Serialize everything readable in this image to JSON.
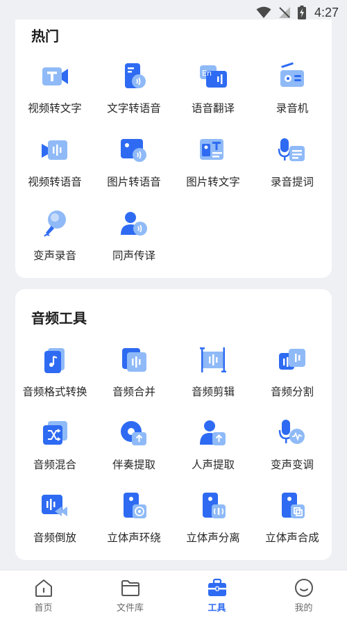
{
  "status": {
    "time": "4:27"
  },
  "colors": {
    "accent": "#2e6bf2",
    "accent_light": "#8fbaf7",
    "card": "#ffffff",
    "bg": "#eef0f4"
  },
  "hot": {
    "title": "热门",
    "items": [
      {
        "label": "视频转文字",
        "icon": "video-to-text-icon"
      },
      {
        "label": "文字转语音",
        "icon": "text-to-speech-icon"
      },
      {
        "label": "语音翻译",
        "icon": "voice-translate-icon"
      },
      {
        "label": "录音机",
        "icon": "recorder-icon"
      },
      {
        "label": "视频转语音",
        "icon": "video-to-audio-icon"
      },
      {
        "label": "图片转语音",
        "icon": "image-to-speech-icon"
      },
      {
        "label": "图片转文字",
        "icon": "image-to-text-icon"
      },
      {
        "label": "录音提词",
        "icon": "teleprompter-icon"
      },
      {
        "label": "变声录音",
        "icon": "voice-changer-record-icon"
      },
      {
        "label": "同声传译",
        "icon": "simultaneous-interpret-icon"
      }
    ]
  },
  "audio": {
    "title": "音频工具",
    "items": [
      {
        "label": "音频格式转换",
        "icon": "audio-format-convert-icon"
      },
      {
        "label": "音频合并",
        "icon": "audio-merge-icon"
      },
      {
        "label": "音频剪辑",
        "icon": "audio-cut-icon"
      },
      {
        "label": "音频分割",
        "icon": "audio-split-icon"
      },
      {
        "label": "音频混合",
        "icon": "audio-mix-icon"
      },
      {
        "label": "伴奏提取",
        "icon": "accompaniment-extract-icon"
      },
      {
        "label": "人声提取",
        "icon": "vocal-extract-icon"
      },
      {
        "label": "变声变调",
        "icon": "pitch-change-icon"
      },
      {
        "label": "音频倒放",
        "icon": "audio-reverse-icon"
      },
      {
        "label": "立体声环绕",
        "icon": "stereo-surround-icon"
      },
      {
        "label": "立体声分离",
        "icon": "stereo-separate-icon"
      },
      {
        "label": "立体声合成",
        "icon": "stereo-compose-icon"
      }
    ]
  },
  "tabs": [
    {
      "label": "首页",
      "icon": "home-icon",
      "active": false
    },
    {
      "label": "文件库",
      "icon": "folder-icon",
      "active": false
    },
    {
      "label": "工具",
      "icon": "toolbox-icon",
      "active": true
    },
    {
      "label": "我的",
      "icon": "profile-icon",
      "active": false
    }
  ]
}
